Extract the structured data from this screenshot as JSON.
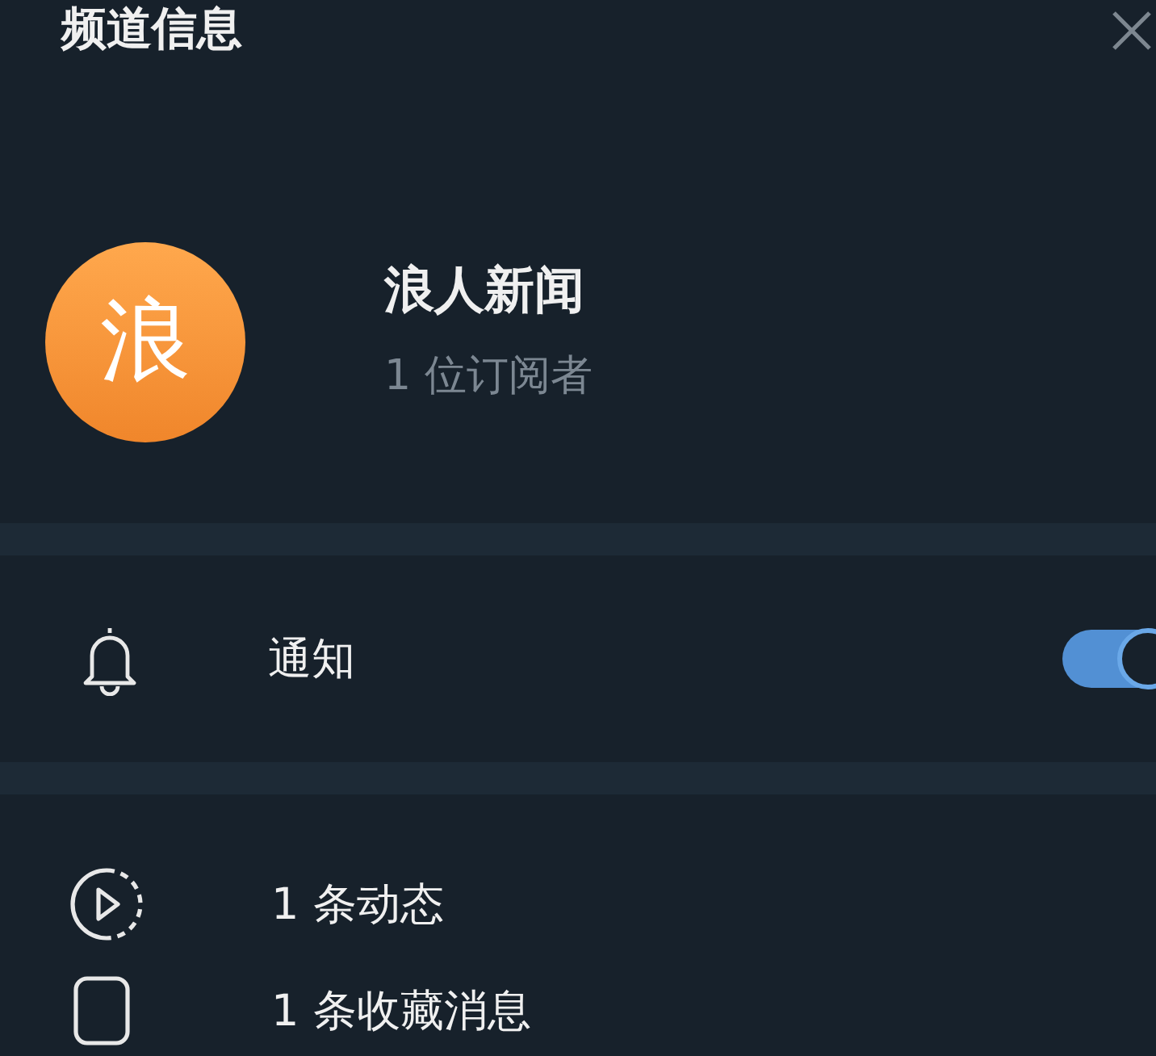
{
  "header": {
    "title": "频道信息"
  },
  "channel": {
    "avatar_letter": "浪",
    "name": "浪人新闻",
    "subscribers": "1 位订阅者"
  },
  "notifications": {
    "label": "通知",
    "on": true
  },
  "stats": [
    {
      "kind": "posts",
      "label": "1 条动态"
    },
    {
      "kind": "saved",
      "label": "1 条收藏消息"
    }
  ]
}
